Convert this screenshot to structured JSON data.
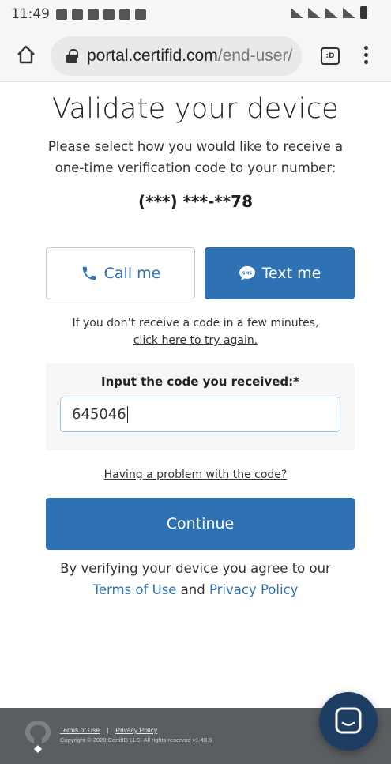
{
  "status_bar": {
    "time": "11:49"
  },
  "browser": {
    "url_domain": "portal.certifid.com",
    "url_path": "/end-user/",
    "tab_switcher_label": ":D"
  },
  "page": {
    "title": "Validate your device",
    "subtitle": "Please select how you would like to receive a one-time verification code to your number:",
    "phone_number": "(***) ***-**78",
    "call_button": "Call me",
    "text_button": "Text me",
    "resend_note": "If you don’t receive a code in a few minutes,",
    "resend_link": "click here to try again.",
    "code_label": "Input the code you received:*",
    "code_value": "645046",
    "problem_link": "Having a problem with the code?",
    "continue_button": "Continue",
    "agree_prefix": "By verifying your device you agree to our",
    "terms_link": "Terms of Use",
    "agree_and": "and",
    "privacy_link": "Privacy Policy"
  },
  "footer": {
    "terms_link": "Terms of Use",
    "separator": "|",
    "privacy_link": "Privacy Policy",
    "copyright": "Copyright © 2020 CertifID LLC. All rights reserved v1.48.0"
  },
  "colors": {
    "accent": "#2f72b3",
    "footer_bg": "#5a5d61",
    "chat_bg": "#1e3d63"
  }
}
